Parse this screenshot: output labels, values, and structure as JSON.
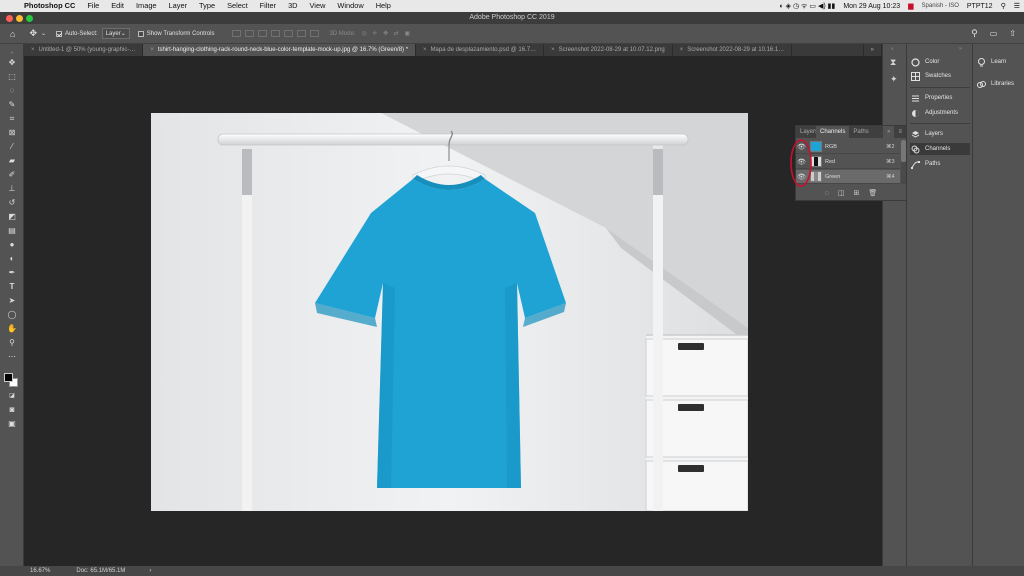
{
  "menubar": {
    "app": "Photoshop CC",
    "items": [
      "File",
      "Edit",
      "Image",
      "Layer",
      "Type",
      "Select",
      "Filter",
      "3D",
      "View",
      "Window",
      "Help"
    ],
    "datetime": "Mon 29 Aug  10:23",
    "input_source": "Spanish - ISO",
    "user": "PTPT12"
  },
  "window": {
    "title": "Adobe Photoshop CC 2019"
  },
  "options": {
    "auto_select_label": "Auto-Select:",
    "auto_select_value": "Layer",
    "transform_label": "Show Transform Controls",
    "mode_3d": "3D Mode:"
  },
  "tabs": [
    {
      "label": "Untitled-1 @ 50% (young-graphic-…",
      "active": false
    },
    {
      "label": "tshirt-hanging-clothing-rack-round-neck-blue-color-template-mock-up.jpg @ 16.7% (Green/8) *",
      "active": true
    },
    {
      "label": "Mapa de desplazamiento.psd @ 16.7…",
      "active": false
    },
    {
      "label": "Screenshot 2022-08-29 at 10.07.12.png",
      "active": false
    },
    {
      "label": "Screenshot 2022-08-29 at 10.16.1…",
      "active": false
    }
  ],
  "status": {
    "zoom": "16.67%",
    "doc": "Doc: 65.1M/65.1M"
  },
  "panels_col2": {
    "color": "Color",
    "swatches": "Swatches",
    "properties": "Properties",
    "adjustments": "Adjustments",
    "layers": "Layers",
    "channels": "Channels",
    "paths": "Paths"
  },
  "panels_col3": {
    "learn": "Learn",
    "libraries": "Libraries"
  },
  "channels_panel": {
    "tabs": [
      "Layers",
      "Channels",
      "Paths"
    ],
    "active_tab": "Channels",
    "rows": [
      {
        "name": "RGB",
        "shortcut": "⌘2",
        "active": false
      },
      {
        "name": "Red",
        "shortcut": "⌘3",
        "active": false
      },
      {
        "name": "Green",
        "shortcut": "⌘4",
        "active": true
      }
    ]
  },
  "colors": {
    "accent_circle": "#c8102e",
    "shirt": "#1ea3d4",
    "ps_bg": "#262626",
    "panel": "#535353"
  },
  "icons": [
    "apple-icon",
    "move-tool-icon",
    "eye-icon",
    "search-icon",
    "workspace-icon",
    "share-icon"
  ]
}
